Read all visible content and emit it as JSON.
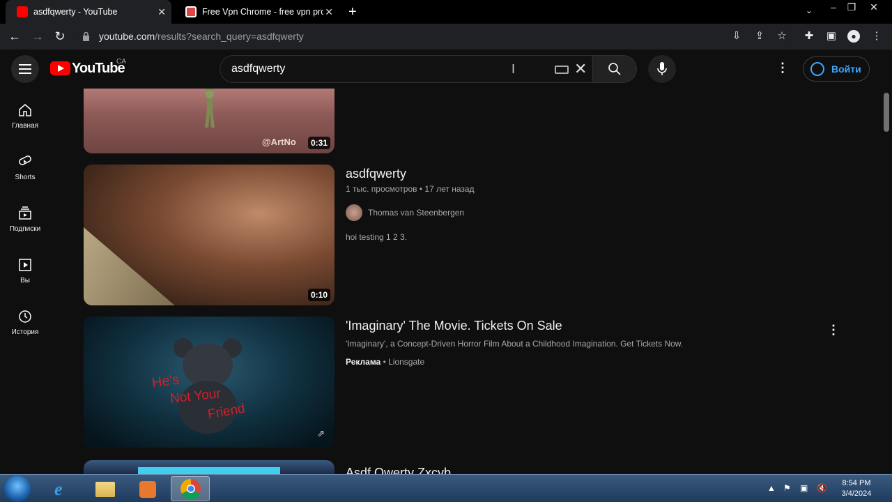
{
  "browser": {
    "tabs": [
      {
        "title": "asdfqwerty - YouTube",
        "active": true
      },
      {
        "title": "Free Vpn Chrome - free vpn prox",
        "active": false
      }
    ],
    "url_host": "youtube.com",
    "url_path": "/results?search_query=asdfqwerty"
  },
  "header": {
    "logo_text": "YouTube",
    "country_code": "CA",
    "search_value": "asdfqwerty",
    "signin_label": "Войти"
  },
  "sidebar": {
    "items": [
      {
        "label": "Главная",
        "icon": "home-icon"
      },
      {
        "label": "Shorts",
        "icon": "shorts-icon"
      },
      {
        "label": "Подписки",
        "icon": "subscriptions-icon"
      },
      {
        "label": "Вы",
        "icon": "you-icon"
      },
      {
        "label": "История",
        "icon": "history-icon"
      }
    ]
  },
  "results": [
    {
      "duration": "0:31",
      "watermark": "@ArtNo"
    },
    {
      "title": "asdfqwerty",
      "views": "1 тыс. просмотров",
      "age": "17 лет назад",
      "channel": "Thomas van Steenbergen",
      "description": "hoi testing 1 2 3.",
      "duration": "0:10"
    },
    {
      "title": "'Imaginary' The Movie. Tickets On Sale",
      "description": "'Imaginary', a Concept-Driven Horror Film About a Childhood Imagination. Get Tickets Now.",
      "ad_label": "Реклама",
      "advertiser": "Lionsgate",
      "thumb_text_1": "He's",
      "thumb_text_2": "Not Your",
      "thumb_text_3": "Friend"
    },
    {
      "title": "Asdf Qwerty Zxcvb"
    }
  ],
  "taskbar": {
    "time": "8:54 PM",
    "date": "3/4/2024"
  }
}
